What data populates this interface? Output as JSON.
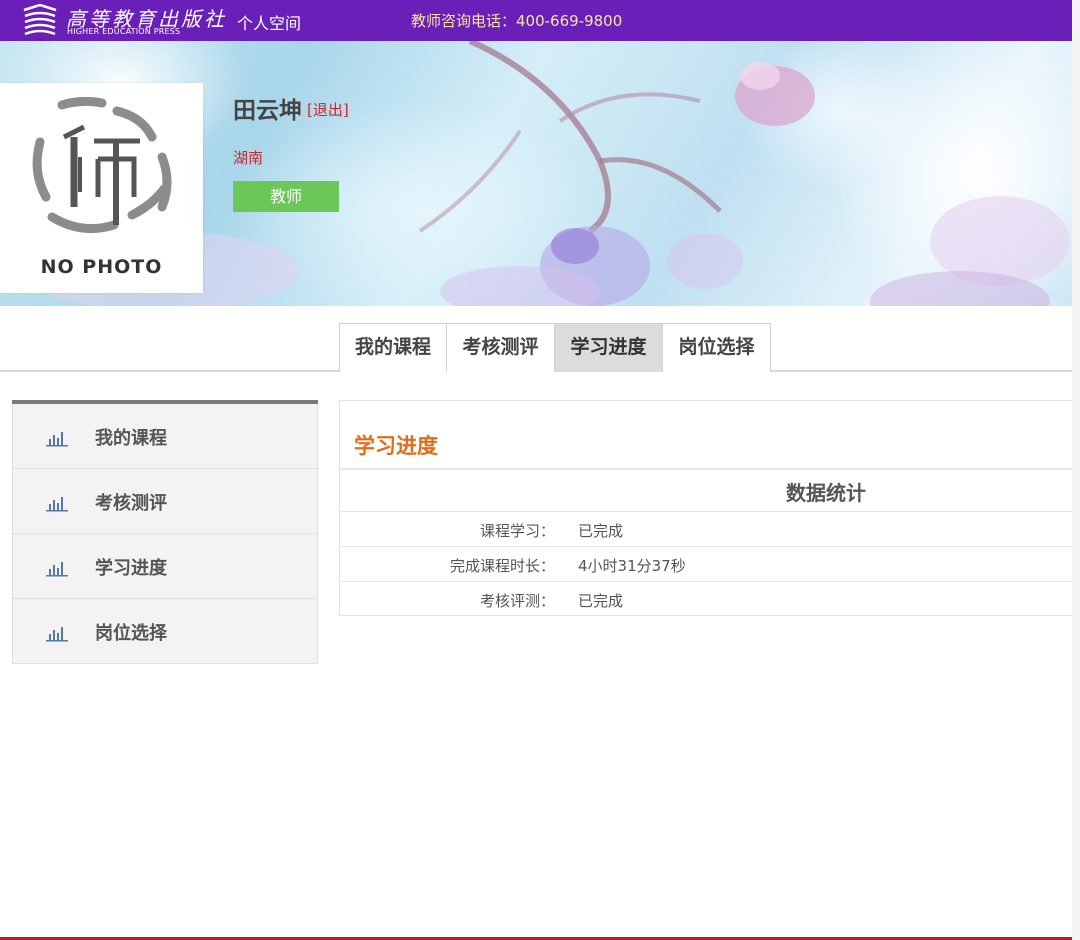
{
  "header": {
    "logo_cn": "高等教育出版社",
    "logo_en": "HIGHER EDUCATION PRESS",
    "nav_personal_space": "个人空间",
    "hotline": "教师咨询电话：400-669-9800",
    "bg_color": "#6a1fb9"
  },
  "profile": {
    "avatar_text": "NO PHOTO",
    "name": "田云坤",
    "logout": "[退出]",
    "region": "湖南",
    "role": "教师",
    "role_color": "#6bc75a"
  },
  "tabs": [
    {
      "label": "我的课程",
      "active": false
    },
    {
      "label": "考核测评",
      "active": false
    },
    {
      "label": "学习进度",
      "active": true
    },
    {
      "label": "岗位选择",
      "active": false
    }
  ],
  "sidebar": {
    "icon": "bar-chart-icon",
    "items": [
      {
        "label": "我的课程"
      },
      {
        "label": "考核测评"
      },
      {
        "label": "学习进度"
      },
      {
        "label": "岗位选择"
      }
    ]
  },
  "progress": {
    "title": "学习进度",
    "stats_title": "数据统计",
    "rows": [
      {
        "label": "课程学习：",
        "value": "已完成"
      },
      {
        "label": "完成课程时长：",
        "value": "4小时31分37秒"
      },
      {
        "label": "考核评测：",
        "value": "已完成"
      }
    ]
  }
}
